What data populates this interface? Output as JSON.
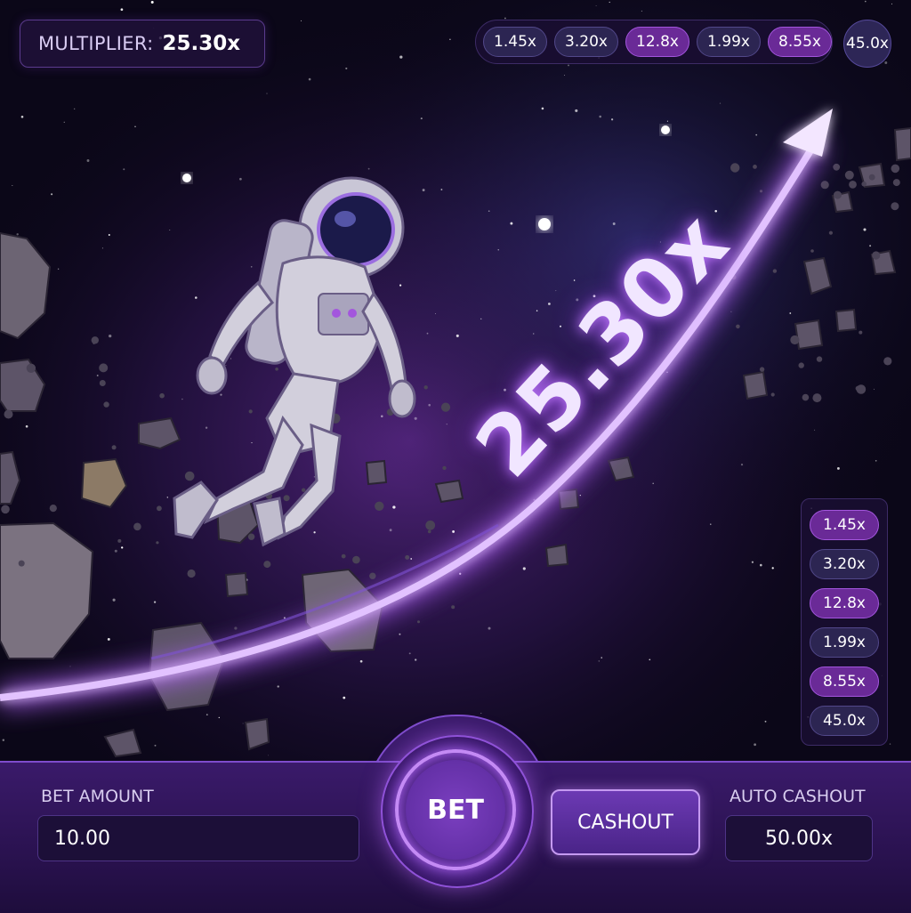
{
  "header": {
    "multiplier_label": "MULTIPLIER:",
    "multiplier_value": "25.30x"
  },
  "history_top": [
    "1.45x",
    "3.20x",
    "12.8x",
    "1.99x",
    "8.55x",
    "45.0x"
  ],
  "history_side": [
    "1.45x",
    "3.20x",
    "12.8x",
    "1.99x",
    "8.55x",
    "45.0x"
  ],
  "curve_multiplier": "25.30x",
  "controls": {
    "bet_amount_label": "BET AMOUNT",
    "bet_amount_value": "10.00",
    "bet_button": "BET",
    "cashout_button": "CASHOUT",
    "auto_cashout_label": "AUTO CASHOUT",
    "auto_cashout_value": "50.00x"
  },
  "colors": {
    "accent": "#a356dd",
    "curve": "#c98cff",
    "background": "#0b0718"
  }
}
